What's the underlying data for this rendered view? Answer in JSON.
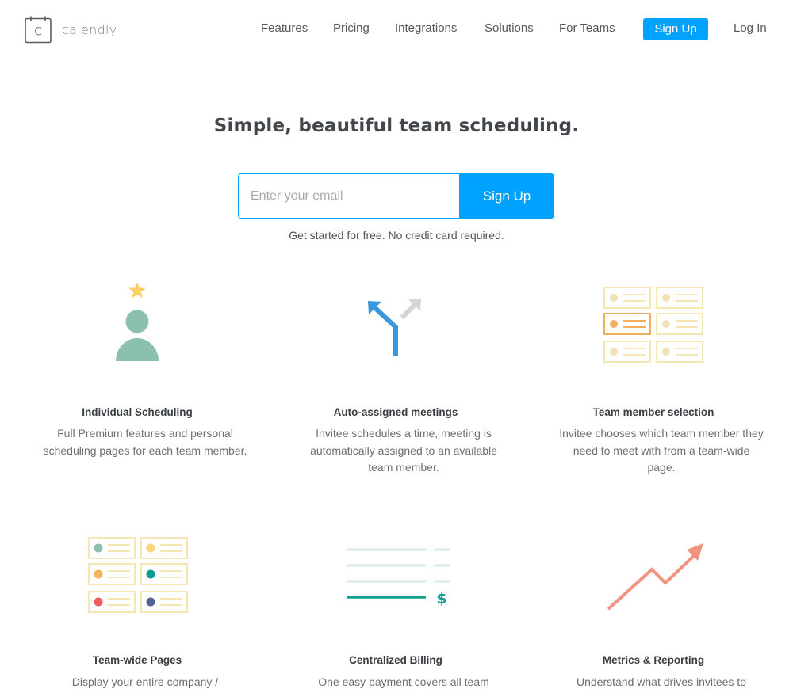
{
  "header": {
    "logo": {
      "icon": "calendar-c-icon",
      "icon_letter": "C",
      "text": "calendly"
    },
    "nav": [
      {
        "label": "Features"
      },
      {
        "label": "Pricing"
      },
      {
        "label": "Integrations"
      },
      {
        "label": "Solutions"
      },
      {
        "label": "For Teams"
      }
    ],
    "signup_label": "Sign Up",
    "login_label": "Log In"
  },
  "hero": {
    "title": "Simple, beautiful team scheduling.",
    "email_placeholder": "Enter your email",
    "email_value": "",
    "signup_label": "Sign Up",
    "note": "Get started for free. No credit card required."
  },
  "features": [
    {
      "icon": "person-star-icon",
      "title": "Individual Scheduling",
      "description": "Full Premium features and personal scheduling pages for each team member."
    },
    {
      "icon": "fork-arrow-icon",
      "title": "Auto-assigned meetings",
      "description": "Invitee schedules a time, meeting is automatically assigned to an available team member."
    },
    {
      "icon": "member-grid-icon",
      "title": "Team member selection",
      "description": "Invitee chooses which team member they need to meet with from a team-wide page."
    },
    {
      "icon": "team-pages-grid-icon",
      "title": "Team-wide Pages",
      "description": "Display your entire company /"
    },
    {
      "icon": "billing-dollar-icon",
      "title": "Centralized Billing",
      "description": "One easy payment covers all team"
    },
    {
      "icon": "trend-arrow-icon",
      "title": "Metrics & Reporting",
      "description": "Understand what drives invitees to"
    }
  ],
  "colors": {
    "accent": "#00a2ff",
    "person": "#8bbfae",
    "star": "#ffd065",
    "fork_blue": "#3a96dd",
    "fork_gray": "#d3d5d6",
    "grid_border": "#f5e6b4",
    "grid_dot": "#f0e2b3",
    "selected_orange": "#f3ae5b",
    "dot_green": "#8bbfae",
    "dot_yellow": "#ffd57a",
    "dot_orange": "#f5b15c",
    "dot_teal": "#0a9e8e",
    "dot_red": "#f15d5e",
    "dot_navy": "#4e6293",
    "billing_light": "#d4ebe5",
    "billing_teal": "#10a090",
    "trend": "#f29382"
  }
}
